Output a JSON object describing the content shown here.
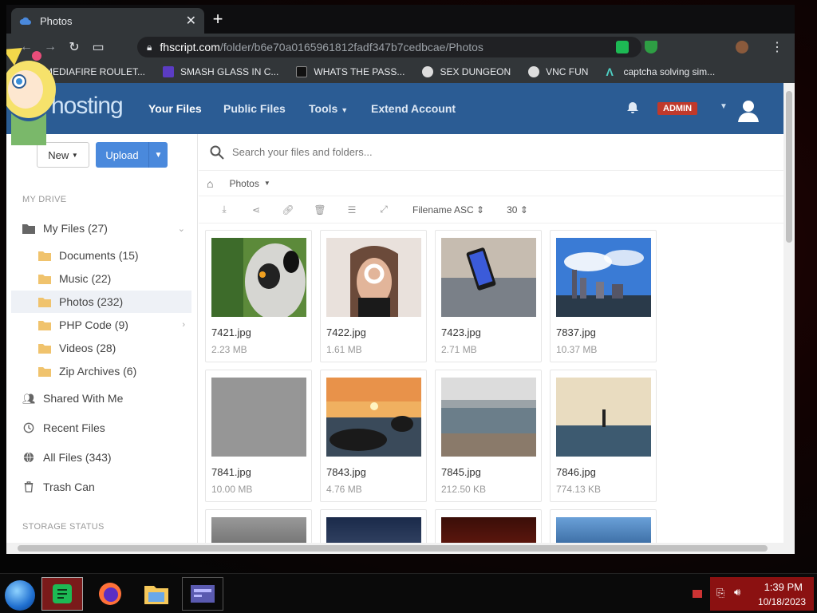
{
  "browser": {
    "tab_title": "Photos",
    "url_domain": "fhscript.com",
    "url_path": "/folder/b6e70a0165961812fadf347b7cedbcae/Photos",
    "bookmarks": [
      {
        "label": "MEDIAFIRE ROULET...",
        "icon": "sticker-icon"
      },
      {
        "label": "SMASH GLASS IN C...",
        "icon": "purple-bookmark-icon"
      },
      {
        "label": "WHATS THE PASS...",
        "icon": "dark-bookmark-icon"
      },
      {
        "label": "SEX DUNGEON",
        "icon": "gear-bookmark-icon"
      },
      {
        "label": "VNC FUN",
        "icon": "gear-bookmark-icon"
      },
      {
        "label": "captcha solving sim...",
        "icon": "lambda-bookmark-icon"
      }
    ]
  },
  "app": {
    "logo": "hosting",
    "nav": [
      "Your Files",
      "Public Files",
      "Tools",
      "Extend Account"
    ],
    "admin_badge": "ADMIN",
    "new_label": "New",
    "upload_label": "Upload",
    "search_placeholder": "Search your files and folders...",
    "breadcrumb": "Photos",
    "sort_label": "Filename ASC",
    "per_page": "30",
    "sidebar": {
      "section_drive": "MY DRIVE",
      "my_files": "My Files (27)",
      "folders": [
        {
          "label": "Documents (15)"
        },
        {
          "label": "Music (22)"
        },
        {
          "label": "Photos (232)"
        },
        {
          "label": "PHP Code (9)"
        },
        {
          "label": "Videos (28)"
        },
        {
          "label": "Zip Archives (6)"
        }
      ],
      "links": [
        {
          "label": "Shared With Me",
          "icon": "users-icon"
        },
        {
          "label": "Recent Files",
          "icon": "clock-icon"
        },
        {
          "label": "All Files (343)",
          "icon": "globe-icon"
        },
        {
          "label": "Trash Can",
          "icon": "trash-icon"
        }
      ],
      "section_storage": "STORAGE STATUS"
    },
    "files": [
      {
        "name": "7421.jpg",
        "size": "2.23 MB"
      },
      {
        "name": "7422.jpg",
        "size": "1.61 MB"
      },
      {
        "name": "7423.jpg",
        "size": "2.71 MB"
      },
      {
        "name": "7837.jpg",
        "size": "10.37 MB"
      },
      {
        "name": "7841.jpg",
        "size": "10.00 MB"
      },
      {
        "name": "7843.jpg",
        "size": "4.76 MB"
      },
      {
        "name": "7845.jpg",
        "size": "212.50 KB"
      },
      {
        "name": "7846.jpg",
        "size": "774.13 KB"
      }
    ]
  },
  "taskbar": {
    "time": "1:39 PM",
    "date": "10/18/2023"
  },
  "colors": {
    "nav_bg": "#2b5c94",
    "upload_btn": "#4a89dc",
    "admin_badge": "#c0392b",
    "tray_bg": "#8b1111"
  }
}
